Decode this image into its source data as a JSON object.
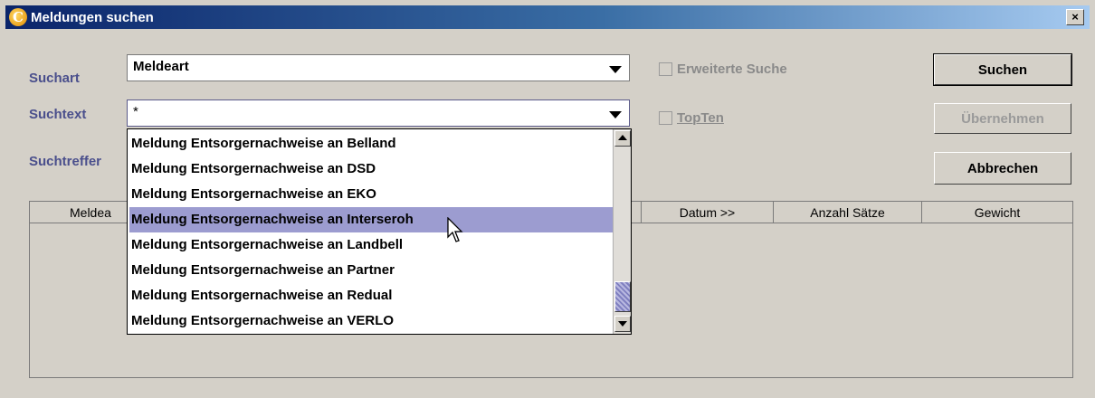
{
  "window": {
    "title": "Meldungen suchen",
    "close_label": "×",
    "app_icon": "C"
  },
  "form": {
    "suchart_label": "Suchart",
    "suchart_value": "Meldeart",
    "suchtext_label": "Suchtext",
    "suchtext_value": "*",
    "suchtreffer_label": "Suchtreffer",
    "erweiterte_suche": "Erweiterte Suche",
    "topten": "TopTen"
  },
  "buttons": {
    "suchen": "Suchen",
    "uebernehmen": "Übernehmen",
    "abbrechen": "Abbrechen"
  },
  "table": {
    "columns": [
      "Meldea",
      "Datum >>",
      "Anzahl Sätze",
      "Gewicht"
    ]
  },
  "dropdown": {
    "items": [
      "Meldung Entsorgernachweise an Belland",
      "Meldung Entsorgernachweise an DSD",
      "Meldung Entsorgernachweise an EKO",
      "Meldung Entsorgernachweise an Interseroh",
      "Meldung Entsorgernachweise an Landbell",
      "Meldung Entsorgernachweise an Partner",
      "Meldung Entsorgernachweise an Redual",
      "Meldung Entsorgernachweise an VERLO"
    ],
    "selected_index": 3
  },
  "colors": {
    "label": "#4a4f8c",
    "selection": "#9c9cd0",
    "titlebar_start": "#0a246a",
    "titlebar_end": "#a6caf0"
  },
  "icons": {
    "app": "app-logo-icon",
    "close": "close-icon",
    "dropdown": "chevron-down-icon",
    "scroll_up": "scroll-up-icon",
    "scroll_down": "scroll-down-icon",
    "cursor": "mouse-pointer-icon"
  }
}
